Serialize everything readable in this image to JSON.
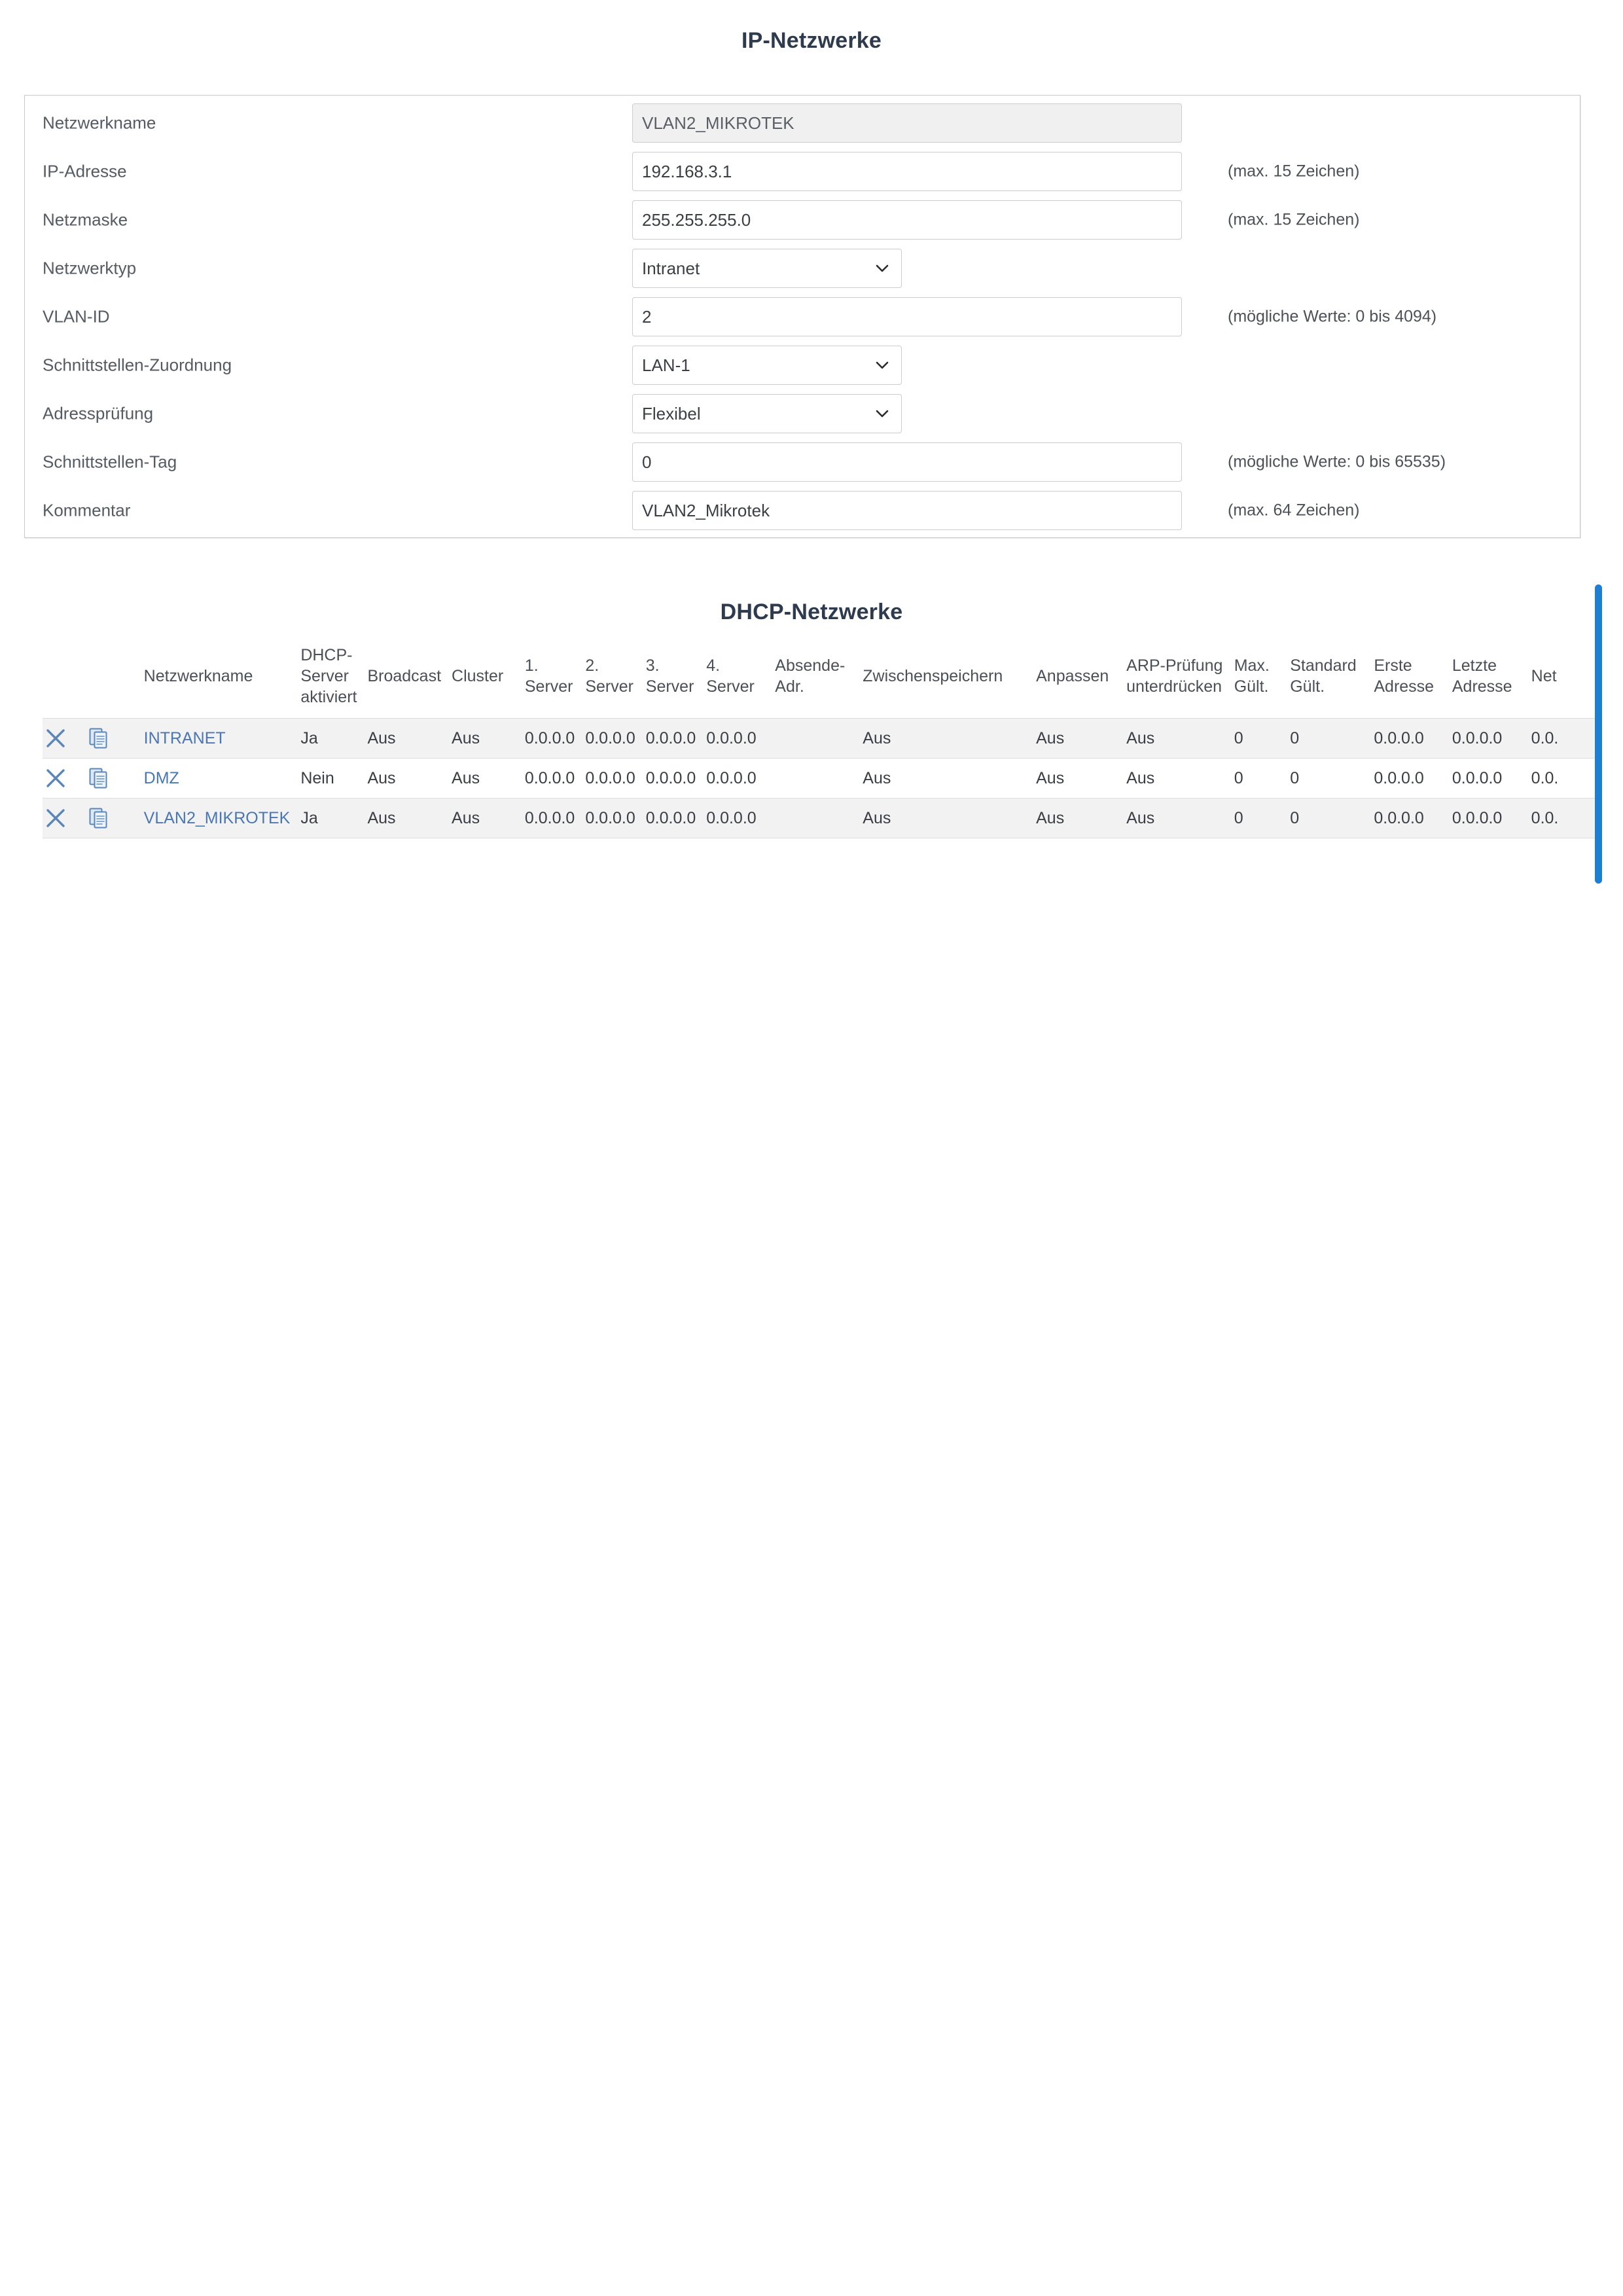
{
  "ip_section": {
    "title": "IP-Netzwerke",
    "fields": [
      {
        "label": "Netzwerkname",
        "type": "text-readonly",
        "value": "VLAN2_MIKROTEK",
        "hint": ""
      },
      {
        "label": "IP-Adresse",
        "type": "text",
        "value": "192.168.3.1",
        "hint": "(max. 15 Zeichen)"
      },
      {
        "label": "Netzmaske",
        "type": "text",
        "value": "255.255.255.0",
        "hint": "(max. 15 Zeichen)"
      },
      {
        "label": "Netzwerktyp",
        "type": "select",
        "value": "Intranet",
        "hint": ""
      },
      {
        "label": "VLAN-ID",
        "type": "text",
        "value": "2",
        "hint": "(mögliche Werte: 0 bis 4094)"
      },
      {
        "label": "Schnittstellen-Zuordnung",
        "type": "select",
        "value": "LAN-1",
        "hint": ""
      },
      {
        "label": "Adressprüfung",
        "type": "select",
        "value": "Flexibel",
        "hint": ""
      },
      {
        "label": "Schnittstellen-Tag",
        "type": "text",
        "value": "0",
        "hint": "(mögliche Werte: 0 bis 65535)"
      },
      {
        "label": "Kommentar",
        "type": "text",
        "value": "VLAN2_Mikrotek",
        "hint": "(max. 64 Zeichen)"
      }
    ]
  },
  "dhcp_section": {
    "title": "DHCP-Netzwerke",
    "row_actions": {
      "delete_icon": "close-x-icon",
      "copy_icon": "copy-duplicate-icon"
    },
    "columns": [
      {
        "key": "name",
        "l1": "Netzwerkname",
        "l2": "",
        "l3": ""
      },
      {
        "key": "dhcp_on",
        "l1": "DHCP-",
        "l2": "Server",
        "l3": "aktiviert"
      },
      {
        "key": "broadcast",
        "l1": "Broadcast",
        "l2": "",
        "l3": ""
      },
      {
        "key": "cluster",
        "l1": "Cluster",
        "l2": "",
        "l3": ""
      },
      {
        "key": "srv1",
        "l1": "1.",
        "l2": "Server",
        "l3": ""
      },
      {
        "key": "srv2",
        "l1": "2.",
        "l2": "Server",
        "l3": ""
      },
      {
        "key": "srv3",
        "l1": "3.",
        "l2": "Server",
        "l3": ""
      },
      {
        "key": "srv4",
        "l1": "4.",
        "l2": "Server",
        "l3": ""
      },
      {
        "key": "sender",
        "l1": "Absende-",
        "l2": "Adr.",
        "l3": ""
      },
      {
        "key": "cache",
        "l1": "Zwischenspeichern",
        "l2": "",
        "l3": ""
      },
      {
        "key": "adapt",
        "l1": "Anpassen",
        "l2": "",
        "l3": ""
      },
      {
        "key": "arp",
        "l1": "ARP-Prüfung",
        "l2": "unterdrücken",
        "l3": ""
      },
      {
        "key": "max_valid",
        "l1": "Max.",
        "l2": "Gült.",
        "l3": ""
      },
      {
        "key": "std_valid",
        "l1": "Standard",
        "l2": "Gült.",
        "l3": ""
      },
      {
        "key": "first_addr",
        "l1": "Erste",
        "l2": "Adresse",
        "l3": ""
      },
      {
        "key": "last_addr",
        "l1": "Letzte",
        "l2": "Adresse",
        "l3": ""
      },
      {
        "key": "netmask",
        "l1": "Net",
        "l2": "",
        "l3": ""
      }
    ],
    "rows": [
      {
        "name": "INTRANET",
        "dhcp_on": "Ja",
        "broadcast": "Aus",
        "cluster": "Aus",
        "srv1": "0.0.0.0",
        "srv2": "0.0.0.0",
        "srv3": "0.0.0.0",
        "srv4": "0.0.0.0",
        "sender": "",
        "cache": "Aus",
        "adapt": "Aus",
        "arp": "Aus",
        "max_valid": "0",
        "std_valid": "0",
        "first_addr": "0.0.0.0",
        "last_addr": "0.0.0.0",
        "netmask": "0.0."
      },
      {
        "name": "DMZ",
        "dhcp_on": "Nein",
        "broadcast": "Aus",
        "cluster": "Aus",
        "srv1": "0.0.0.0",
        "srv2": "0.0.0.0",
        "srv3": "0.0.0.0",
        "srv4": "0.0.0.0",
        "sender": "",
        "cache": "Aus",
        "adapt": "Aus",
        "arp": "Aus",
        "max_valid": "0",
        "std_valid": "0",
        "first_addr": "0.0.0.0",
        "last_addr": "0.0.0.0",
        "netmask": "0.0."
      },
      {
        "name": "VLAN2_MIKROTEK",
        "dhcp_on": "Ja",
        "broadcast": "Aus",
        "cluster": "Aus",
        "srv1": "0.0.0.0",
        "srv2": "0.0.0.0",
        "srv3": "0.0.0.0",
        "srv4": "0.0.0.0",
        "sender": "",
        "cache": "Aus",
        "adapt": "Aus",
        "arp": "Aus",
        "max_valid": "0",
        "std_valid": "0",
        "first_addr": "0.0.0.0",
        "last_addr": "0.0.0.0",
        "netmask": "0.0."
      }
    ]
  },
  "colors": {
    "title": "#2e3b4e",
    "link": "#4a77b4",
    "icon": "#5b86b8",
    "scrollbar": "#1c7fd4",
    "row_alt": "#f2f2f2",
    "readonly_field": "#f0f0f0"
  },
  "scrollbar": {
    "name": "vertical-scrollbar"
  }
}
